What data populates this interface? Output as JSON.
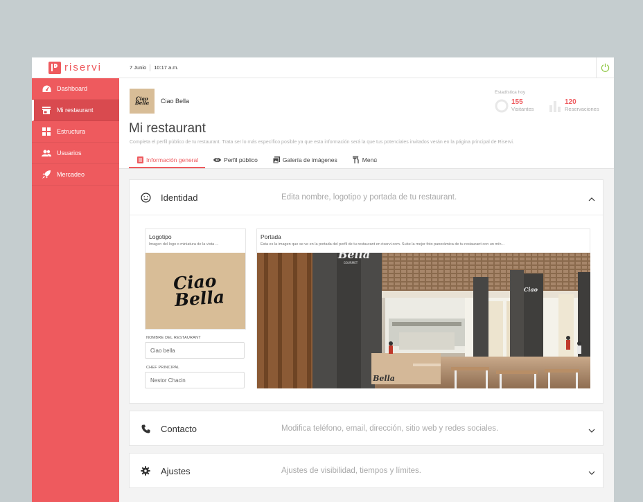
{
  "brand": {
    "name": "riservi",
    "accent": "#ee5a5e"
  },
  "sidebar": {
    "items": [
      {
        "label": "Dashboard",
        "icon": "dashboard-icon"
      },
      {
        "label": "Mi restaurant",
        "icon": "store-icon"
      },
      {
        "label": "Estructura",
        "icon": "grid-icon"
      },
      {
        "label": "Usuarios",
        "icon": "users-icon"
      },
      {
        "label": "Mercadeo",
        "icon": "rocket-icon"
      }
    ],
    "active": "Mi restaurant"
  },
  "topbar": {
    "date": "7 Junio",
    "time": "10:17 a.m."
  },
  "restaurant": {
    "name": "Ciao Bella",
    "logo_text_line1": "Ciao",
    "logo_text_line2": "Bella"
  },
  "stats": {
    "label": "Estadística hoy",
    "visitors": {
      "value": "155",
      "label": "Visitantes"
    },
    "reservations": {
      "value": "120",
      "label": "Reservaciones"
    }
  },
  "page": {
    "title": "Mi restaurant",
    "description": "Completa el perfil público de tu restaurant. Trata ser lo más específico posible ya que esta información será la que tus potenciales invitados verán en la página principal de Riservi."
  },
  "tabs": [
    {
      "label": "Información general",
      "icon": "document-icon"
    },
    {
      "label": "Perfil público",
      "icon": "eye-icon"
    },
    {
      "label": "Galería de imágenes",
      "icon": "gallery-icon"
    },
    {
      "label": "Menú",
      "icon": "utensils-icon"
    }
  ],
  "panels": {
    "identidad": {
      "title": "Identidad",
      "description": "Edita nombre, logotipo y portada de tu restaurant.",
      "icon": "smiley-icon",
      "expanded": true
    },
    "contacto": {
      "title": "Contacto",
      "description": "Modifica teléfono, email, dirección, sitio web y redes sociales.",
      "icon": "phone-icon"
    },
    "ajustes": {
      "title": "Ajustes",
      "description": "Ajustes de visibilidad, tiempos y límites.",
      "icon": "gear-icon"
    }
  },
  "logotipo": {
    "title": "Logotipo",
    "subtitle": "Imagen del logo o miniatura de la vista ..."
  },
  "portada": {
    "title": "Portada",
    "subtitle": "Esta es la imagen que se ve en la portada del perfil de tu restaurant en riservi.com. Sube la mejor foto panorámica de tu restaurant con un mín...",
    "sign_text": "Bella",
    "sign_sub": "GOURMET"
  },
  "fields": {
    "nombre": {
      "label": "NOMBRE DEL RESTAURANT",
      "value": "Ciao bella"
    },
    "chef": {
      "label": "CHEF PRINCIPAL",
      "value": "Nestor Chacin"
    }
  }
}
